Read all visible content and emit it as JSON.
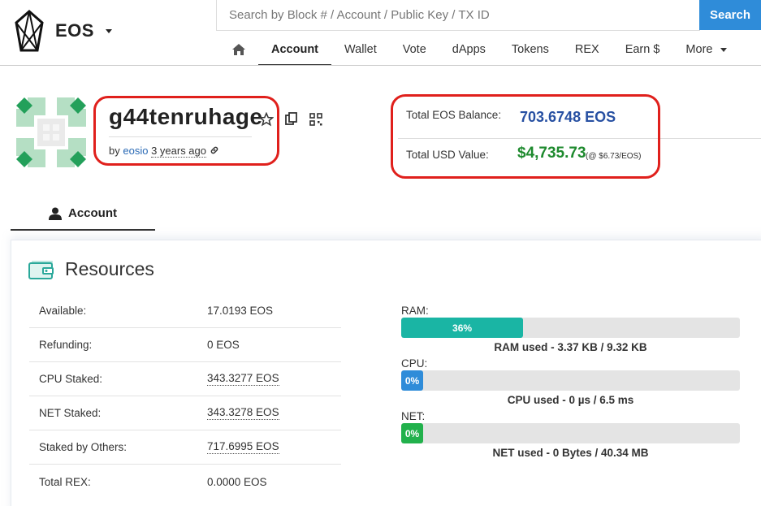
{
  "header": {
    "brand": "EOS",
    "search_placeholder": "Search by Block # / Account / Public Key / TX ID",
    "search_button": "Search"
  },
  "nav": {
    "items": [
      "Account",
      "Wallet",
      "Vote",
      "dApps",
      "Tokens",
      "REX",
      "Earn $",
      "More"
    ],
    "active": "Account"
  },
  "account": {
    "name": "g44tenruhage",
    "by_prefix": "by",
    "creator": "eosio",
    "age": "3 years ago"
  },
  "balances": {
    "eos_label": "Total EOS Balance:",
    "eos_value": "703.6748 EOS",
    "usd_label": "Total USD Value:",
    "usd_value": "$4,735.73",
    "usd_rate": "(@ $6.73/EOS)"
  },
  "tabs": {
    "account": "Account"
  },
  "resources": {
    "title": "Resources",
    "rows": [
      {
        "label": "Available:",
        "value": "17.0193 EOS",
        "dotted": false
      },
      {
        "label": "Refunding:",
        "value": "0 EOS",
        "dotted": false
      },
      {
        "label": "CPU Staked:",
        "value": "343.3277 EOS",
        "dotted": true
      },
      {
        "label": "NET Staked:",
        "value": "343.3278 EOS",
        "dotted": true
      },
      {
        "label": "Staked by Others:",
        "value": "717.6995 EOS",
        "dotted": true
      },
      {
        "label": "Total REX:",
        "value": "0.0000 EOS",
        "dotted": false
      }
    ],
    "meters": {
      "ram": {
        "label": "RAM:",
        "percent_text": "36%",
        "percent": 36,
        "note": "RAM used - 3.37 KB / 9.32 KB",
        "color": "#1ab5a4"
      },
      "cpu": {
        "label": "CPU:",
        "percent_text": "0%",
        "percent": 0,
        "note": "CPU used - 0 µs / 6.5 ms",
        "color": "#2f8cd9"
      },
      "net": {
        "label": "NET:",
        "percent_text": "0%",
        "percent": 0,
        "note": "NET used - 0 Bytes / 40.34 MB",
        "color": "#22b14c"
      }
    }
  },
  "colors": {
    "accent_blue": "#2f8cd9",
    "balance_blue": "#2750a2",
    "usd_green": "#1e8a2e",
    "highlight_red": "#e0201c"
  },
  "icons": [
    "eos-logo-icon",
    "chevron-down-icon",
    "home-icon",
    "star-icon",
    "copy-icon",
    "qr-code-icon",
    "link-icon",
    "user-icon",
    "wallet-icon"
  ]
}
